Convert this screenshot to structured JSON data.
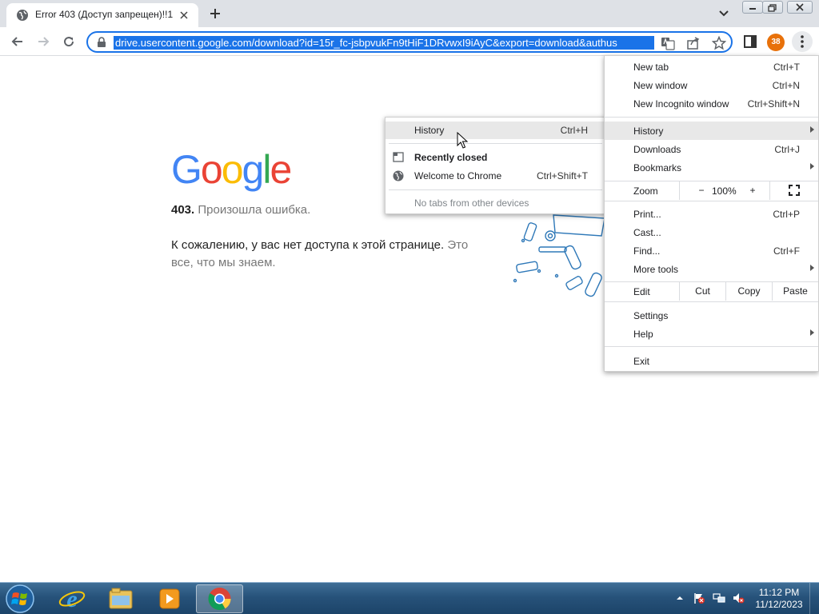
{
  "browser": {
    "tab": {
      "title": "Error 403 (Доступ запрещен)!!1",
      "icon": "globe-icon"
    },
    "omnibox": {
      "url": "drive.usercontent.google.com/download?id=15r_fc-jsbpvukFn9tHiF1DRvwxI9iAyC&export=download&authus"
    },
    "profile_badge": "38"
  },
  "page": {
    "logo": "Google",
    "error_code": "403.",
    "error_text": "Произошла ошибка.",
    "message_main": "К сожалению, у вас нет доступа к этой странице.",
    "message_muted": "Это все, что мы знаем."
  },
  "history_submenu": {
    "history": {
      "label": "History",
      "shortcut": "Ctrl+H"
    },
    "recently_closed": "Recently closed",
    "welcome": {
      "label": "Welcome to Chrome",
      "shortcut": "Ctrl+Shift+T"
    },
    "no_tabs": "No tabs from other devices"
  },
  "menu": {
    "new_tab": {
      "label": "New tab",
      "shortcut": "Ctrl+T"
    },
    "new_window": {
      "label": "New window",
      "shortcut": "Ctrl+N"
    },
    "new_incognito": {
      "label": "New Incognito window",
      "shortcut": "Ctrl+Shift+N"
    },
    "history": {
      "label": "History"
    },
    "downloads": {
      "label": "Downloads",
      "shortcut": "Ctrl+J"
    },
    "bookmarks": {
      "label": "Bookmarks"
    },
    "zoom": {
      "label": "Zoom",
      "minus": "−",
      "value": "100%",
      "plus": "+"
    },
    "print": {
      "label": "Print...",
      "shortcut": "Ctrl+P"
    },
    "cast": {
      "label": "Cast..."
    },
    "find": {
      "label": "Find...",
      "shortcut": "Ctrl+F"
    },
    "more_tools": {
      "label": "More tools"
    },
    "edit": {
      "label": "Edit",
      "cut": "Cut",
      "copy": "Copy",
      "paste": "Paste"
    },
    "settings": {
      "label": "Settings"
    },
    "help": {
      "label": "Help"
    },
    "exit": {
      "label": "Exit"
    }
  },
  "taskbar": {
    "clock_time": "11:12 PM",
    "clock_date": "11/12/2023"
  },
  "colors": {
    "accent": "#1a73e8",
    "profile": "#e8710a",
    "taskbar": "#27527a"
  }
}
